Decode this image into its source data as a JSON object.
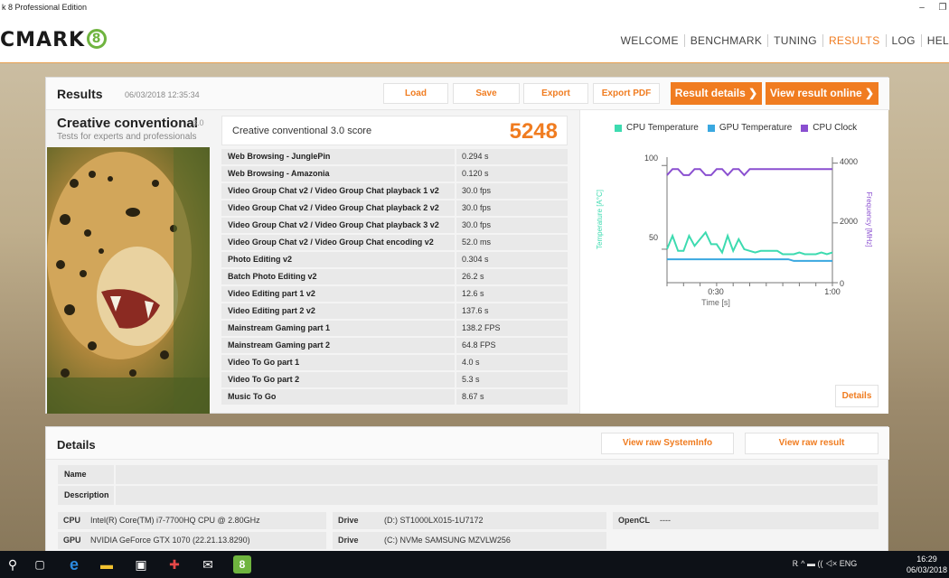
{
  "window": {
    "title": "k 8 Professional Edition",
    "minimize": "–",
    "restore": "❐"
  },
  "logo": {
    "text": "CMARK",
    "mark": "8"
  },
  "nav": [
    "WELCOME",
    "BENCHMARK",
    "TUNING",
    "RESULTS",
    "LOG",
    "HEL"
  ],
  "results": {
    "title": "Results",
    "date": "06/03/2018 12:35:34",
    "buttons": {
      "load": "Load",
      "save": "Save",
      "export": "Export",
      "export_pdf": "Export PDF",
      "result_details": "Result details ❯",
      "view_online": "View result online ❯"
    },
    "test_name": "Creative conventional",
    "test_version": "3.0",
    "test_subtitle": "Tests for experts and professionals",
    "score_label": "Creative conventional 3.0 score",
    "score": "5248",
    "rows": [
      {
        "name": "Web Browsing - JunglePin",
        "value": "0.294 s"
      },
      {
        "name": "Web Browsing - Amazonia",
        "value": "0.120 s"
      },
      {
        "name": "Video Group Chat v2 / Video Group Chat playback 1 v2",
        "value": "30.0 fps"
      },
      {
        "name": "Video Group Chat v2 / Video Group Chat playback 2 v2",
        "value": "30.0 fps"
      },
      {
        "name": "Video Group Chat v2 / Video Group Chat playback 3 v2",
        "value": "30.0 fps"
      },
      {
        "name": "Video Group Chat v2 / Video Group Chat encoding v2",
        "value": "52.0 ms"
      },
      {
        "name": "Photo Editing v2",
        "value": "0.304 s"
      },
      {
        "name": "Batch Photo Editing v2",
        "value": "26.2 s"
      },
      {
        "name": "Video Editing part 1 v2",
        "value": "12.6 s"
      },
      {
        "name": "Video Editing part 2 v2",
        "value": "137.6 s"
      },
      {
        "name": "Mainstream Gaming part 1",
        "value": "138.2 FPS"
      },
      {
        "name": "Mainstream Gaming part 2",
        "value": "64.8 FPS"
      },
      {
        "name": "Video To Go part 1",
        "value": "4.0 s"
      },
      {
        "name": "Video To Go part 2",
        "value": "5.3 s"
      },
      {
        "name": "Music To Go",
        "value": "8.67 s"
      }
    ],
    "details_button": "Details"
  },
  "chart": {
    "legend": [
      "CPU Temperature",
      "GPU Temperature",
      "CPU Clock"
    ],
    "colors": {
      "cpu_temp": "#3ddbb0",
      "gpu_temp": "#3aa8e0",
      "cpu_clock": "#8a4fd0"
    },
    "left_ticks": [
      "100",
      "50"
    ],
    "right_ticks": [
      "4000",
      "2000",
      "0"
    ],
    "x_ticks": [
      "0:30",
      "1:00"
    ],
    "xlabel": "Time [s]",
    "ylabel_left": "Temperature [A°C]",
    "ylabel_right": "Frequency [MHz]"
  },
  "chart_data": {
    "type": "line",
    "xlabel": "Time [s]",
    "x": [
      0,
      2,
      4,
      6,
      8,
      10,
      12,
      14,
      16,
      18,
      20,
      22,
      24,
      26,
      28,
      30,
      32,
      34,
      36,
      38,
      40,
      42,
      44,
      46,
      48,
      50,
      52,
      54,
      56,
      58,
      60
    ],
    "series": [
      {
        "name": "CPU Temperature",
        "axis": "left",
        "unit": "°C",
        "values": [
          50,
          58,
          49,
          49,
          58,
          52,
          56,
          60,
          53,
          53,
          48,
          58,
          49,
          56,
          50,
          49,
          48,
          49,
          49,
          49,
          49,
          47,
          47,
          47,
          48,
          47,
          47,
          47,
          48,
          47,
          48
        ]
      },
      {
        "name": "GPU Temperature",
        "axis": "left",
        "unit": "°C",
        "values": [
          44,
          44,
          44,
          44,
          44,
          44,
          44,
          44,
          44,
          44,
          44,
          44,
          44,
          44,
          44,
          44,
          44,
          44,
          44,
          44,
          44,
          44,
          44,
          43,
          43,
          43,
          43,
          43,
          43,
          43,
          43
        ]
      },
      {
        "name": "CPU Clock",
        "axis": "right",
        "unit": "MHz",
        "values": [
          3600,
          3800,
          3800,
          3600,
          3600,
          3800,
          3800,
          3600,
          3600,
          3800,
          3800,
          3600,
          3800,
          3800,
          3600,
          3800,
          3800,
          3800,
          3800,
          3800,
          3800,
          3800,
          3800,
          3800,
          3800,
          3800,
          3800,
          3800,
          3800,
          3800,
          3800
        ]
      }
    ],
    "ylim_left": [
      30,
      105
    ],
    "ylim_right": [
      0,
      4200
    ],
    "grid": false,
    "legend": "top"
  },
  "details": {
    "title": "Details",
    "view_sysinfo": "View raw SystemInfo",
    "view_raw": "View raw result",
    "name_label": "Name",
    "desc_label": "Description",
    "cpu_label": "CPU",
    "cpu": "Intel(R) Core(TM) i7-7700HQ CPU @ 2.80GHz",
    "gpu_label": "GPU",
    "gpu": "NVIDIA GeForce GTX 1070 (22.21.13.8290)",
    "drive_label": "Drive",
    "drive1": "(D:) ST1000LX015-1U7172",
    "drive2": "(C:) NVMe SAMSUNG MZVLW256",
    "opencl_label": "OpenCL",
    "opencl": "----"
  },
  "taskbar": {
    "search": "⚲",
    "task_view": "▢",
    "edge": "e",
    "files": "▬",
    "store": "▣",
    "gift": "✚",
    "mail": "✉",
    "app": "8",
    "tray": "Ꭱ   ^  ▬  ((  ◁×  ENG",
    "time": "16:29",
    "date": "06/03/2018"
  }
}
